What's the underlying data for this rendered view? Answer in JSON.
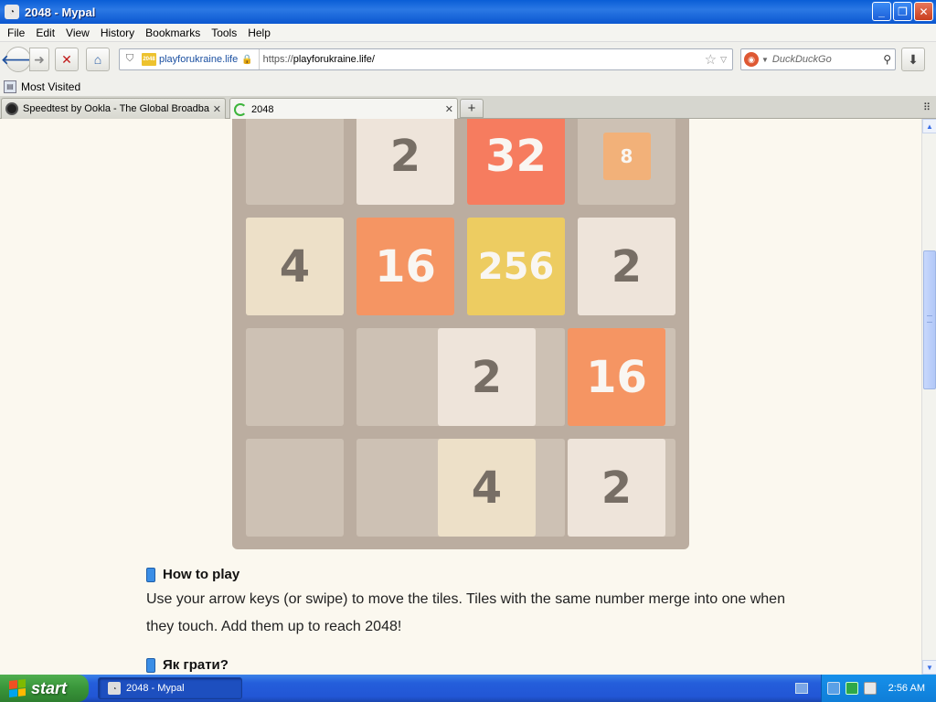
{
  "window": {
    "title": "2048 - Mypal"
  },
  "menu": [
    "File",
    "Edit",
    "View",
    "History",
    "Bookmarks",
    "Tools",
    "Help"
  ],
  "navbar": {
    "site_name": "playforukraine.life",
    "favicon_text": "2048",
    "url_prefix": "https://",
    "url_host": "playforukraine.life/",
    "search_placeholder": "DuckDuckGo"
  },
  "bookmarks": {
    "most_visited": "Most Visited"
  },
  "tabs": [
    {
      "label": "Speedtest by Ookla - The Global Broadba...",
      "active": false
    },
    {
      "label": "2048",
      "active": true
    }
  ],
  "board": {
    "rows": [
      [
        null,
        2,
        32,
        8
      ],
      [
        4,
        16,
        256,
        2
      ],
      [
        null,
        null,
        2,
        16
      ],
      [
        null,
        null,
        4,
        2
      ]
    ]
  },
  "tile_colors": {
    "2": {
      "bg": "#eee4da",
      "fg": "#776e65"
    },
    "4": {
      "bg": "#ede0c8",
      "fg": "#776e65"
    },
    "8": {
      "bg": "#f2b179",
      "fg": "#f9f6f2"
    },
    "16": {
      "bg": "#f59563",
      "fg": "#f9f6f2"
    },
    "32": {
      "bg": "#f67c5f",
      "fg": "#f9f6f2"
    },
    "256": {
      "bg": "#edcc61",
      "fg": "#f9f6f2"
    }
  },
  "content": {
    "how_to_play_heading": "How to play",
    "how_to_play_text": "Use your arrow keys (or swipe) to move the tiles. Tiles with the same number merge into one when they touch. Add them up to reach 2048!",
    "uk_heading": "Як грати?"
  },
  "taskbar": {
    "start_label": "start",
    "task_label": "2048 - Mypal",
    "clock": "2:56 AM"
  }
}
